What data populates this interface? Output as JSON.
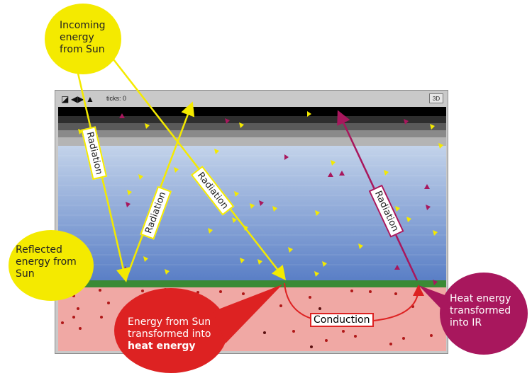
{
  "toolbar": {
    "ticks": "ticks: 0",
    "btn3d": "3D"
  },
  "callouts": {
    "incoming": [
      "Incoming",
      "energy",
      "from Sun"
    ],
    "reflected": [
      "Reflected",
      "energy from",
      "Sun"
    ],
    "sun_heat": [
      "Energy from Sun",
      "transformed into",
      "heat energy"
    ],
    "heat_ir": [
      "Heat energy",
      "transformed",
      "into IR"
    ]
  },
  "labels": {
    "radiation": "Radiation",
    "conduction": "Conduction"
  },
  "colors": {
    "yellow": "#f4ea00",
    "red": "#dd2222",
    "magenta": "#a8175d",
    "ground": "#f0a8a4",
    "grass": "#3a8a35"
  }
}
